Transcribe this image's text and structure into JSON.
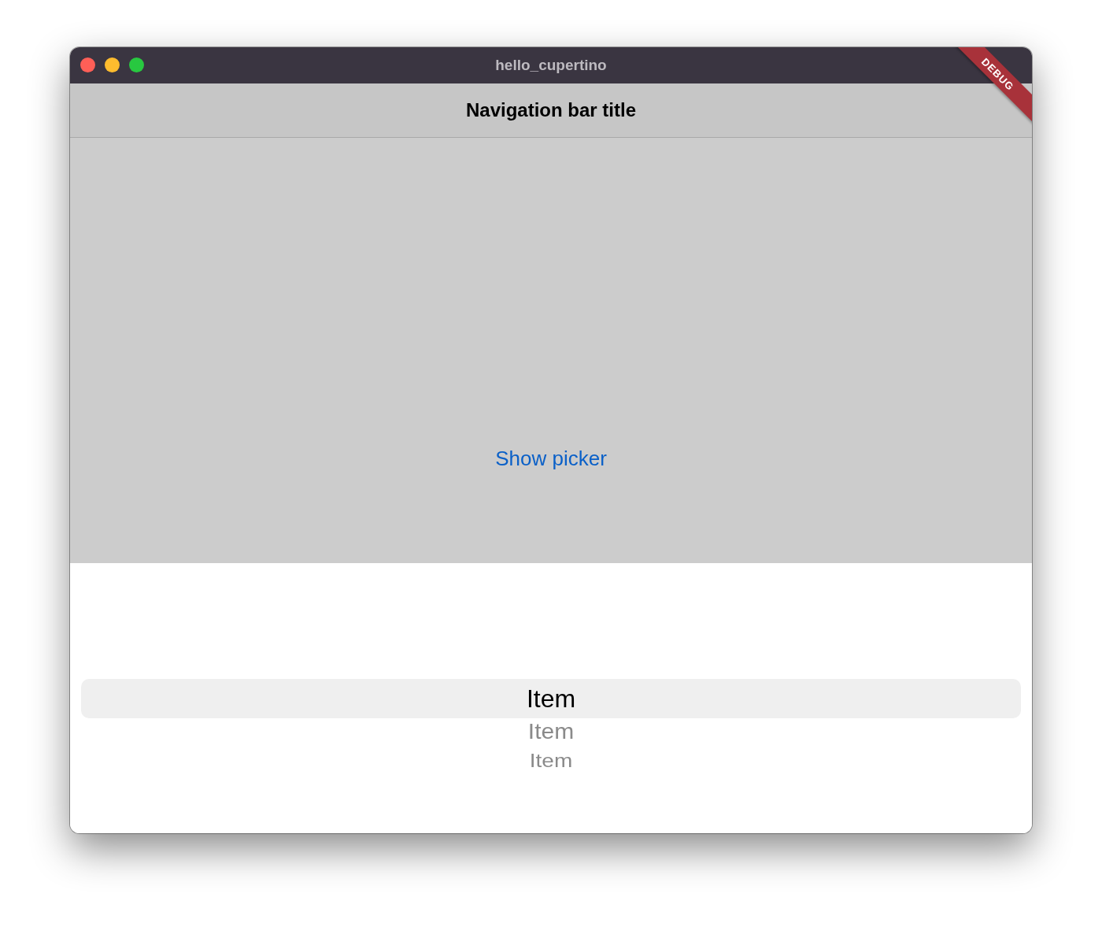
{
  "window": {
    "title": "hello_cupertino"
  },
  "navigation_bar": {
    "title": "Navigation bar title"
  },
  "debug_banner": "DEBUG",
  "button": {
    "label": "Show picker"
  },
  "picker": {
    "items": [
      {
        "label": "Item",
        "selected": true
      },
      {
        "label": "Item",
        "selected": false
      },
      {
        "label": "Item",
        "selected": false
      }
    ]
  }
}
